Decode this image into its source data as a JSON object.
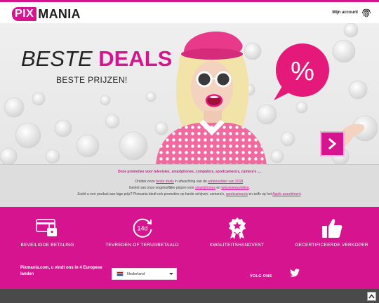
{
  "header": {
    "logo_pix": "PIX",
    "logo_mania": "MANIA",
    "account_label": "Mijn account"
  },
  "hero": {
    "title_light": "BESTE",
    "title_bold": "DEALS",
    "subtitle": "BESTE PRIJZEN!",
    "bubble_symbol": "%"
  },
  "promo": {
    "headline": "Onze promoties voor televisies, smartphones, computers, sportcamera's, camera's ....",
    "line1_pre": "Ontdek onze",
    "line1_link1": "beste deals",
    "line1_mid": "in afwachting van de",
    "line1_link2": "wintersolden van 2018",
    "line1_post": ".",
    "line2_pre": "Geniet van onze ongelooflijke prijzen voor",
    "line2_link1": "smartphones",
    "line2_mid": "en",
    "line2_link2": "televisietoestellen",
    "line2_post": ".",
    "line3_pre": "Zoekt u een product aan lage prijs? Pixmania biedt ook promoties op harde schijven, camera's,",
    "line3_link1": "sportcamera's",
    "line3_mid": "en zelfs op het",
    "line3_link2": "Apple-assortiment",
    "line3_post": "."
  },
  "features": [
    {
      "label": "BEVEILIGDE BETALING",
      "icon": "secure-card-icon"
    },
    {
      "label": "TEVREDEN OF TERUGBETAALD",
      "icon": "14-days-icon",
      "icon_text": "14d"
    },
    {
      "label": "KWALITEITSHANDVEST",
      "icon": "quality-ribbon-icon"
    },
    {
      "label": "GECERTIFICEERDE VERKOPER",
      "icon": "thumbs-up-icon"
    }
  ],
  "footer": {
    "text": "Pixmania.com, u vindt ons in 4 Europese landen",
    "country_selected": "Nederland",
    "follow_label": "VOLG ONS",
    "social_icon": "twitter-icon"
  },
  "colors": {
    "brand": "#d6148f",
    "promo_bg": "#dddddd",
    "bottom_bar": "#4a4a4a"
  }
}
